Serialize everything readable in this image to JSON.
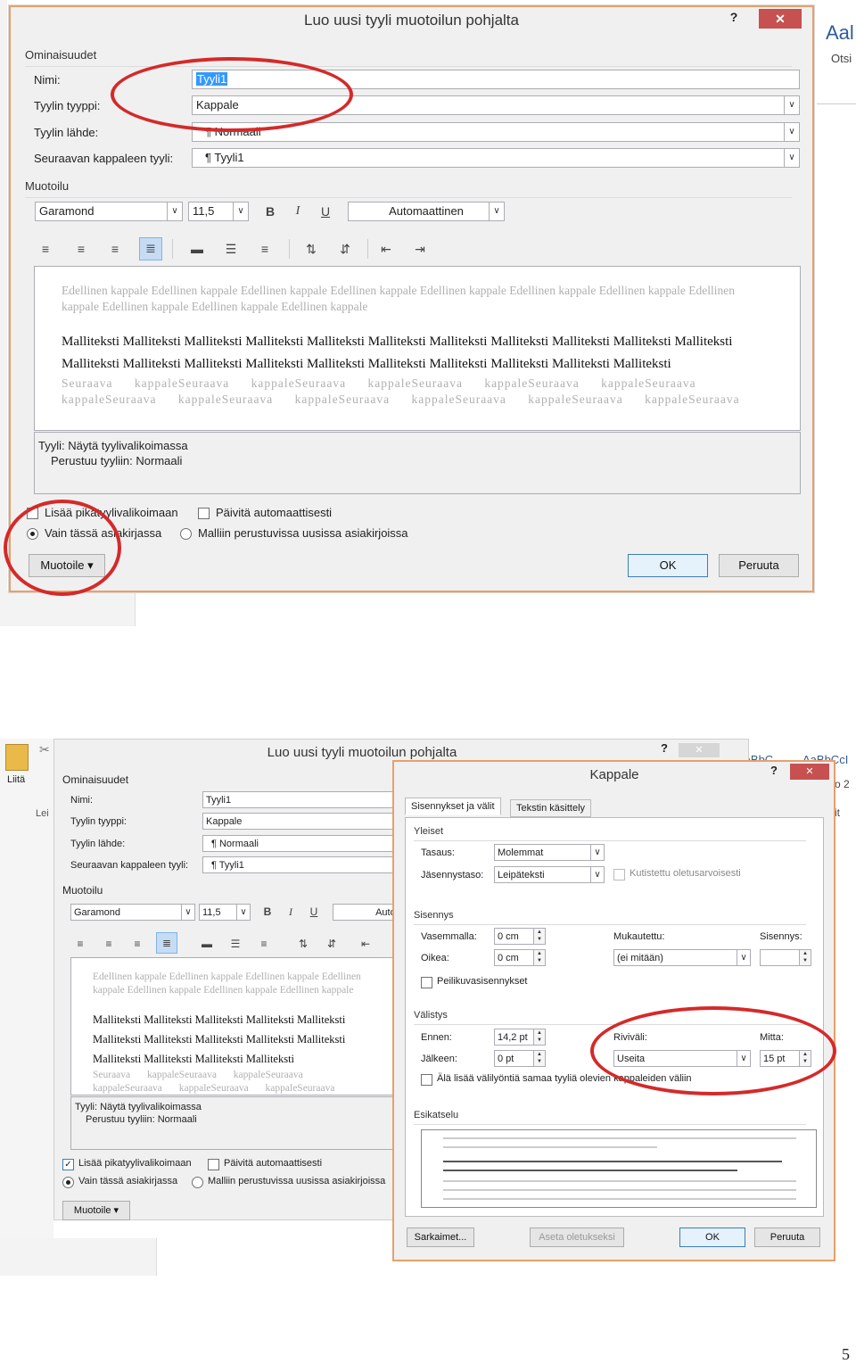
{
  "top": {
    "title": "Luo uusi tyyli muotoilun pohjalta",
    "help": "?",
    "close": "✕",
    "bg_right": [
      "Aal",
      "Otsi"
    ],
    "properties_section": "Ominaisuudet",
    "name_label": "Nimi:",
    "name_value": "Tyyli1",
    "type_label": "Tyylin tyyppi:",
    "type_value": "Kappale",
    "base_label": "Tyylin lähde:",
    "base_value": "¶ Normaali",
    "next_label": "Seuraavan kappaleen tyyli:",
    "next_value": "¶ Tyyli1",
    "format_section": "Muotoilu",
    "font": "Garamond",
    "size": "11,5",
    "bold": "B",
    "italic": "I",
    "underline": "U",
    "color": "Automaattinen",
    "preview_prev": "Edellinen kappale Edellinen kappale Edellinen kappale Edellinen kappale Edellinen kappale Edellinen kappale Edellinen kappale Edellinen kappale Edellinen kappale Edellinen kappale Edellinen kappale",
    "preview_sample": "Malliteksti Malliteksti Malliteksti Malliteksti Malliteksti Malliteksti Malliteksti Malliteksti Malliteksti Malliteksti Malliteksti Malliteksti Malliteksti Malliteksti Malliteksti Malliteksti Malliteksti Malliteksti Malliteksti Malliteksti Malliteksti",
    "preview_next": "Seuraava kappaleSeuraava kappaleSeuraava kappaleSeuraava kappaleSeuraava kappaleSeuraava kappaleSeuraava kappaleSeuraava kappaleSeuraava kappaleSeuraava kappaleSeuraava kappaleSeuraava",
    "desc_line1": "Tyyli: Näytä tyylivalikoimassa",
    "desc_line2": "Perustuu tyyliin: Normaali",
    "add_gallery": "Lisää pikatyylivalikoimaan",
    "auto_update": "Päivitä automaattisesti",
    "only_doc": "Vain tässä asiakirjassa",
    "new_docs": "Malliin perustuvissa uusissa asiakirjoissa",
    "format_btn": "Muotoile ▾",
    "ok": "OK",
    "cancel": "Peruuta"
  },
  "bottom": {
    "ribbon_paste": "Liitä",
    "ribbon_lei": "Lei",
    "bg_right": [
      "AaBbC",
      "AaBbCcI",
      "o 2",
      "it"
    ],
    "title": "Luo uusi tyyli muotoilun pohjalta",
    "help": "?",
    "close": "✕",
    "properties_section": "Ominaisuudet",
    "name_label": "Nimi:",
    "name_value": "Tyyli1",
    "type_label": "Tyylin tyyppi:",
    "type_value": "Kappale",
    "base_label": "Tyylin lähde:",
    "base_value": "¶ Normaali",
    "next_label": "Seuraavan kappaleen tyyli:",
    "next_value": "¶ Tyyli1",
    "format_section": "Muotoilu",
    "font": "Garamond",
    "size": "11,5",
    "bold": "B",
    "italic": "I",
    "underline": "U",
    "color": "Automa",
    "preview_prev": "Edellinen kappale Edellinen kappale Edellinen kappale Edellinen kappale Edellinen kappale Edellinen kappale Edellinen kappale Edellinen kappale Edellinen kappale Edellinen",
    "preview_sample": "Malliteksti Malliteksti Malliteksti Malliteksti Malliteksti Malliteksti Malliteksti Malliteksti Malliteksti Malliteksti Malliteksti Malliteksti Malliteksti Malliteksti",
    "preview_next": "Seuraava kappaleSeuraava kappaleSeuraava kappaleSeuraava kappaleSeuraava kappaleSeuraava kappaleSeuraava",
    "desc_line1": "Tyyli: Näytä tyylivalikoimassa",
    "desc_line2": "Perustuu tyyliin: Normaali",
    "add_gallery": "Lisää pikatyylivalikoimaan",
    "auto_update": "Päivitä automaattisesti",
    "only_doc": "Vain tässä asiakirjassa",
    "new_docs": "Malliin perustuvissa uusissa asiakirjoissa",
    "format_btn": "Muotoile ▾"
  },
  "para": {
    "title": "Kappale",
    "help": "?",
    "close": "✕",
    "tab1": "Sisennykset ja välit",
    "tab2": "Tekstin käsittely",
    "general": "Yleiset",
    "align_label": "Tasaus:",
    "align_value": "Molemmat",
    "level_label": "Jäsennystaso:",
    "level_value": "Leipäteksti",
    "collapsed": "Kutistettu oletusarvoisesti",
    "indent": "Sisennys",
    "left_label": "Vasemmalla:",
    "left_value": "0 cm",
    "right_label": "Oikea:",
    "right_value": "0 cm",
    "special_label": "Mukautettu:",
    "special_value": "(ei mitään)",
    "by_label": "Sisennys:",
    "by_value": "",
    "mirror": "Peilikuvasisennykset",
    "spacing": "Välistys",
    "before_label": "Ennen:",
    "before_value": "14,2 pt",
    "after_label": "Jälkeen:",
    "after_value": "0 pt",
    "line_label": "Riviväli:",
    "line_value": "Useita",
    "at_label": "Mitta:",
    "at_value": "15 pt",
    "dont_add": "Älä lisää välilyöntiä samaa tyyliä olevien kappaleiden väliin",
    "preview": "Esikatselu",
    "tabs_btn": "Sarkaimet...",
    "default_btn": "Aseta oletukseksi",
    "ok": "OK",
    "cancel": "Peruuta"
  },
  "page_number": "5"
}
